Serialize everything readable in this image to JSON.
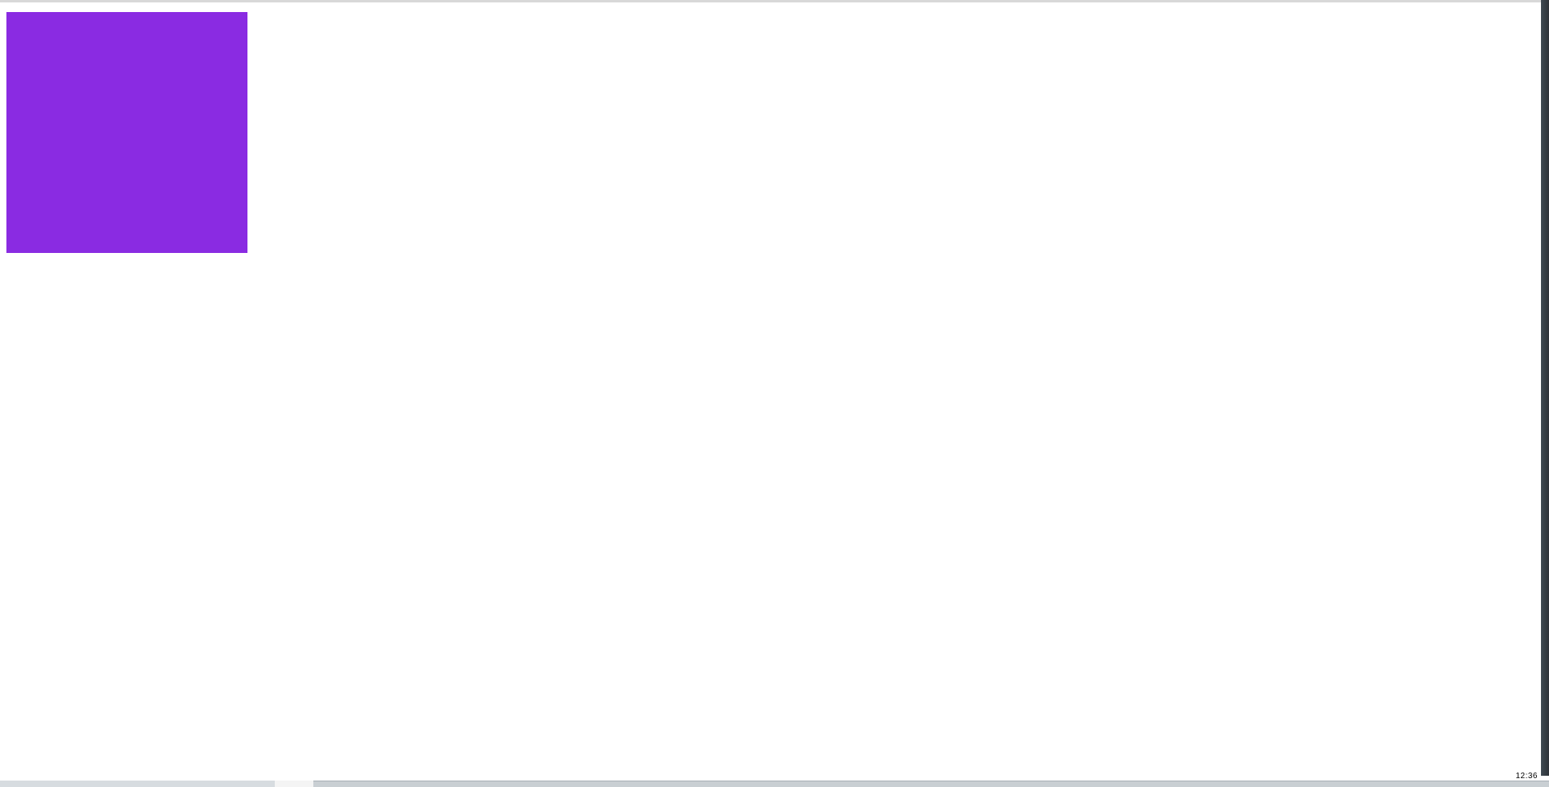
{
  "content": {
    "box_color": "#8a2be2"
  },
  "taskbar": {
    "clock": "12:36"
  }
}
